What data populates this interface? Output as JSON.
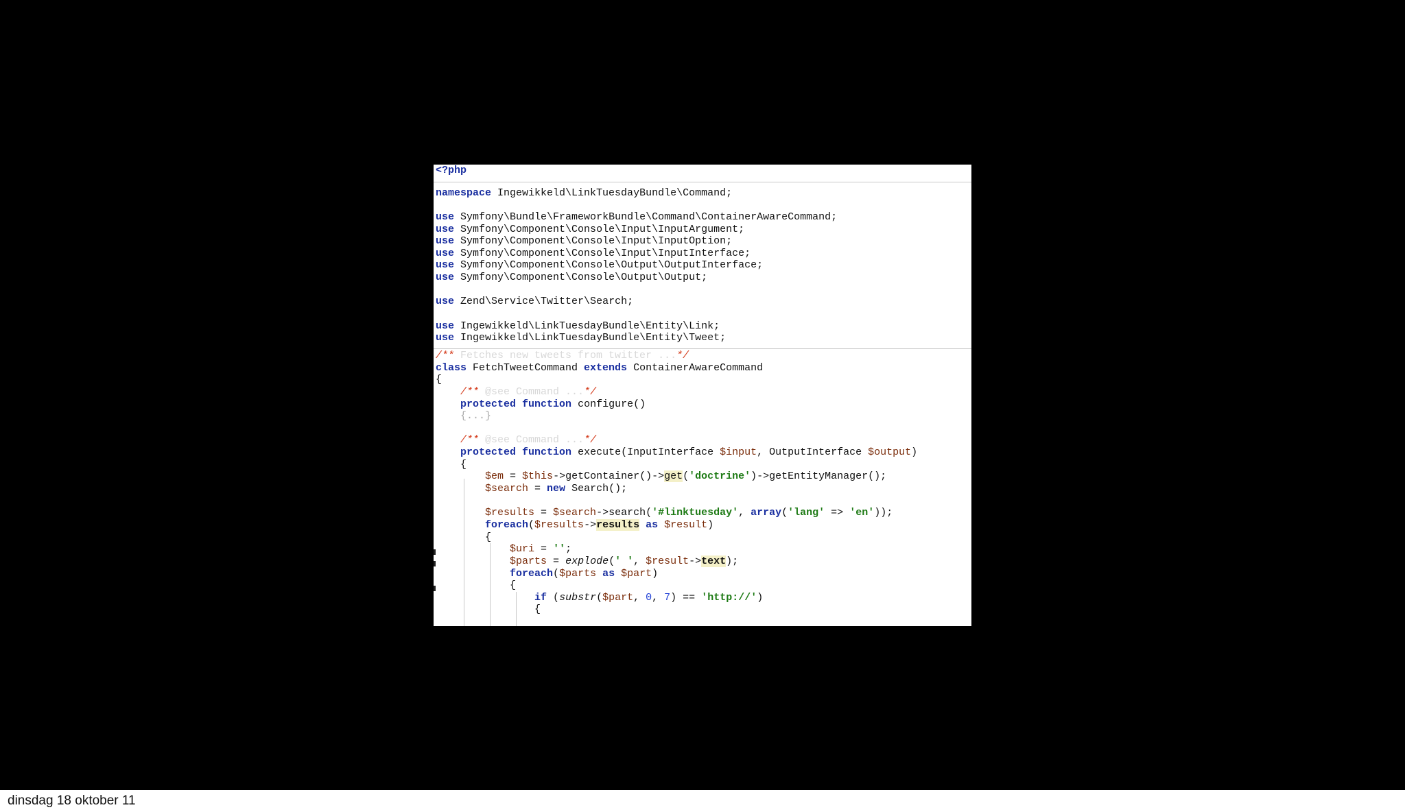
{
  "code": {
    "open_tag": "<?php",
    "namespace_kw": "namespace",
    "namespace_name": "Ingewikkeld\\LinkTuesdayBundle\\Command;",
    "use_kw": "use",
    "uses_group1": [
      "Symfony\\Bundle\\FrameworkBundle\\Command\\ContainerAwareCommand;",
      "Symfony\\Component\\Console\\Input\\InputArgument;",
      "Symfony\\Component\\Console\\Input\\InputOption;",
      "Symfony\\Component\\Console\\Input\\InputInterface;",
      "Symfony\\Component\\Console\\Output\\OutputInterface;",
      "Symfony\\Component\\Console\\Output\\Output;"
    ],
    "uses_group2": [
      "Zend\\Service\\Twitter\\Search;"
    ],
    "uses_group3": [
      "Ingewikkeld\\LinkTuesdayBundle\\Entity\\Link;",
      "Ingewikkeld\\LinkTuesdayBundle\\Entity\\Tweet;"
    ],
    "class_doc_open": "/** ",
    "class_doc_text": "Fetches new tweets from twitter ...",
    "doc_close": "*/",
    "class_kw": "class",
    "class_name": " FetchTweetCommand ",
    "extends_kw": "extends",
    "parent_class": " ContainerAwareCommand",
    "see_text": "@see Command ...",
    "protected_kw": "protected",
    "function_kw": "function",
    "configure_sig": " configure()",
    "folded_body": "{...}",
    "execute_name": " execute(InputInterface ",
    "input_var": "$input",
    "execute_mid": ", OutputInterface ",
    "output_var": "$output",
    "em_var": "$em",
    "this_var": "$this",
    "get_container": "->getContainer()->",
    "get_fn": "get",
    "doctrine_str": "'doctrine'",
    "get_entity_manager": ")->getEntityManager();",
    "search_var": "$search",
    "new_kw": "new",
    "search_ctor": " Search();",
    "results_var": "$results",
    "search_call": "->search(",
    "hashtag_str": "'#linktuesday'",
    "array_kw": "array",
    "lang_str": "'lang'",
    "arrow": " => ",
    "en_str": "'en'",
    "foreach_kw": "foreach",
    "results_prop": "results",
    "as_kw": "as",
    "result_var": "$result",
    "uri_var": "$uri",
    "empty_str": "''",
    "parts_var": "$parts",
    "explode_fn": "explode",
    "space_str": "' '",
    "text_prop": "text",
    "part_var": "$part",
    "if_kw": "if",
    "substr_fn": "substr",
    "zero": "0",
    "seven": "7",
    "http_str": "'http://'"
  },
  "footer": {
    "date": "dinsdag 18 oktober 11"
  }
}
